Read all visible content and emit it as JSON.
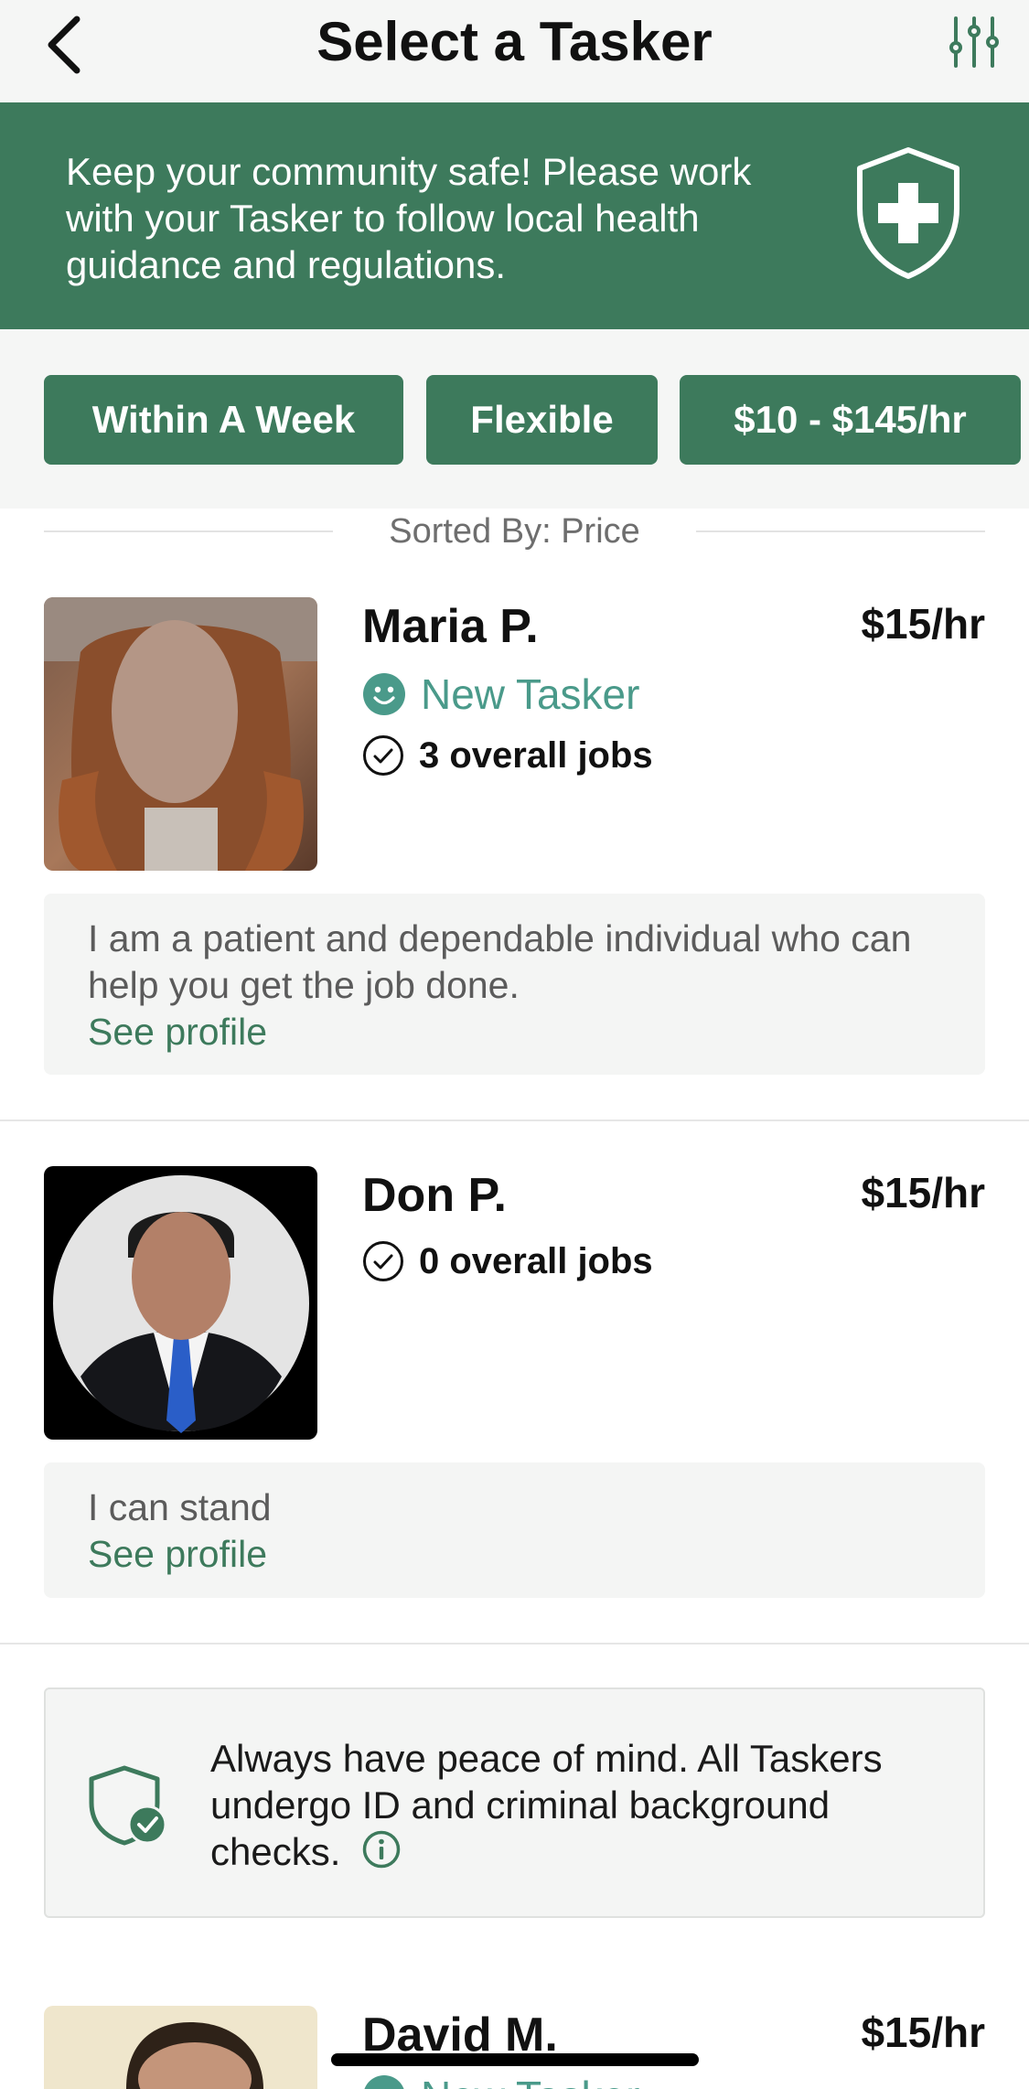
{
  "header": {
    "title": "Select a Tasker",
    "back_icon": "chevron-left-icon",
    "filter_icon": "sliders-icon"
  },
  "banner": {
    "text": "Keep your community safe! Please work with your Tasker to follow local health guidance and regulations.",
    "icon": "shield-plus-icon",
    "background": "#3d7a5c"
  },
  "filters": {
    "chips": [
      {
        "label": "Within A Week"
      },
      {
        "label": "Flexible"
      },
      {
        "label": "$10 - $145/hr"
      }
    ]
  },
  "sort": {
    "label": "Sorted By: Price"
  },
  "taskers": [
    {
      "name": "Maria P.",
      "price": "$15/hr",
      "badge": "New Tasker",
      "jobs": "3 overall jobs",
      "bio": "I am a patient and dependable individual who can help you get the job done.",
      "link": "See profile"
    },
    {
      "name": "Don P.",
      "price": "$15/hr",
      "jobs": "0 overall jobs",
      "bio": "I can stand",
      "link": "See profile"
    },
    {
      "name": "David M.",
      "price": "$15/hr",
      "badge": "New Tasker"
    }
  ],
  "trust": {
    "text": "Always have peace of mind. All Taskers undergo ID and criminal background checks.",
    "icon": "shield-check-icon",
    "info_icon": "info-icon"
  },
  "colors": {
    "accent": "#3d7a5c",
    "badge": "#4a9a8a"
  }
}
